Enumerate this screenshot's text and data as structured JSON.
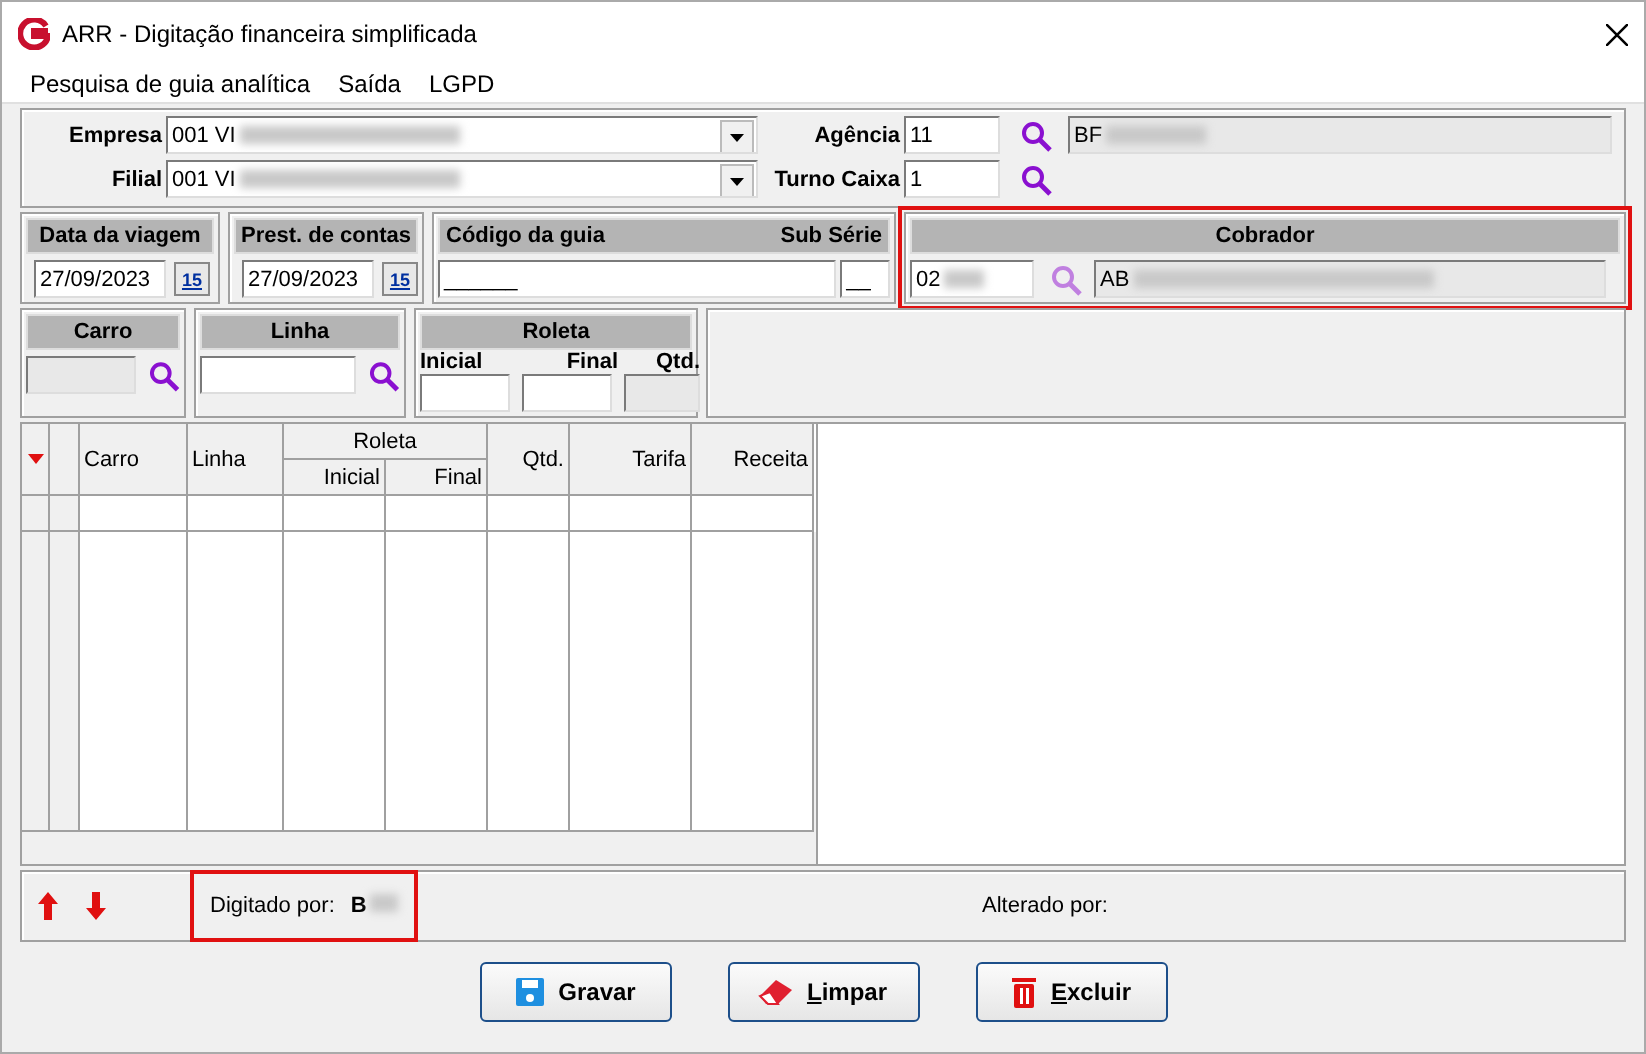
{
  "window": {
    "title": "ARR - Digitação financeira simplificada"
  },
  "menu": [
    {
      "label": "Pesquisa de guia analítica"
    },
    {
      "label": "Saída"
    },
    {
      "label": "LGPD"
    }
  ],
  "empresa": {
    "label": "Empresa",
    "value": "001 VI"
  },
  "filial": {
    "label": "Filial",
    "value": "001 VI"
  },
  "agencia": {
    "label": "Agência",
    "value": "11",
    "name": "BF"
  },
  "turno_caixa": {
    "label": "Turno Caixa",
    "value": "1"
  },
  "data_viagem": {
    "title": "Data da viagem",
    "value": "27/09/2023",
    "calendar": "15"
  },
  "prest_contas": {
    "title": "Prest. de contas",
    "value": "27/09/2023",
    "calendar": "15"
  },
  "codigo_guia": {
    "title": "Código da guia",
    "sub_title": "Sub Série",
    "value": "______",
    "sub_value": "__"
  },
  "cobrador": {
    "title": "Cobrador",
    "code": "02",
    "name": "AB",
    "highlighted": true
  },
  "carro": {
    "title": "Carro",
    "disabled": true
  },
  "linha": {
    "title": "Linha",
    "disabled": false
  },
  "roleta": {
    "title": "Roleta",
    "inicial": "Inicial",
    "final": "Final",
    "qtd": "Qtd."
  },
  "grid": {
    "columns": [
      "Carro",
      "Linha"
    ],
    "group": {
      "title": "Roleta",
      "columns": [
        "Inicial",
        "Final"
      ]
    },
    "after_columns": [
      "Qtd.",
      "Tarifa",
      "Receita"
    ]
  },
  "footer": {
    "digitado": {
      "label": "Digitado por:",
      "value": "B",
      "highlighted": true
    },
    "alterado": {
      "label": "Alterado por:"
    }
  },
  "buttons": [
    {
      "label": "Gravar",
      "kind": "save",
      "underline_first": false
    },
    {
      "label": "Limpar",
      "kind": "clear",
      "underline_first": true
    },
    {
      "label": "Excluir",
      "kind": "delete",
      "underline_first": true
    }
  ]
}
